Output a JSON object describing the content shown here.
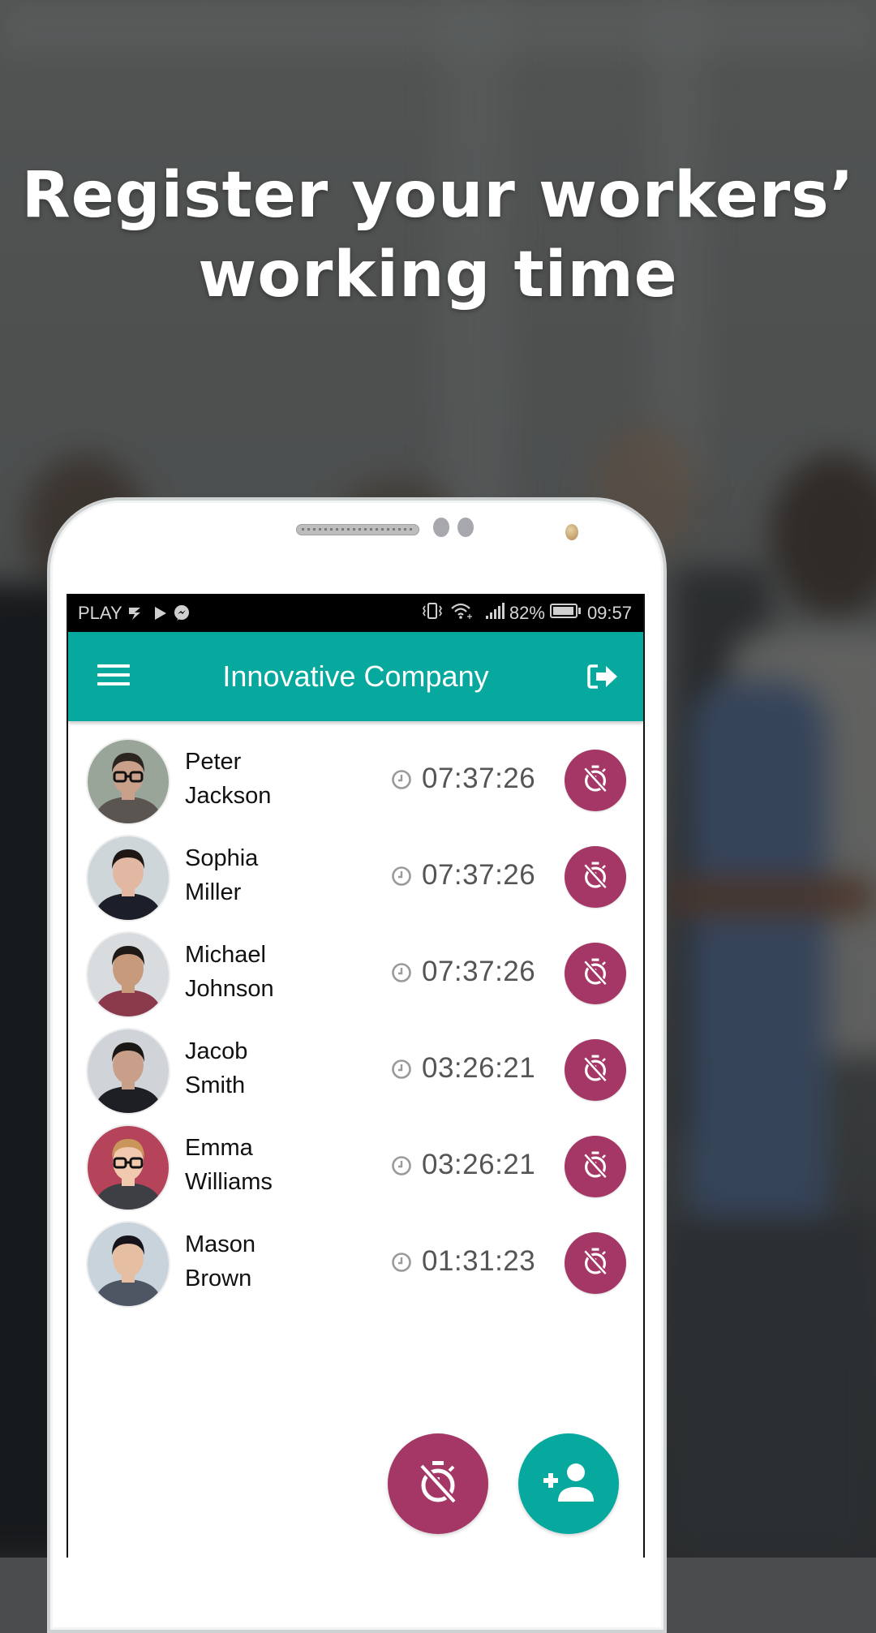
{
  "headline": {
    "line1": "Register your workers’",
    "line2": "working time"
  },
  "status_bar": {
    "carrier": "PLAY",
    "left_icons": [
      "notification-check-icon",
      "play-store-icon",
      "messenger-icon"
    ],
    "right_icons": [
      "vibrate-icon",
      "wifi-icon",
      "signal-icon",
      "battery-icon"
    ],
    "battery": "82%",
    "time": "09:57"
  },
  "app_bar": {
    "title": "Innovative Company",
    "menu_icon": "hamburger-menu-icon",
    "exit_icon": "logout-icon"
  },
  "workers": [
    {
      "first_name": "Peter",
      "last_name": "Jackson",
      "time": "07:37:26",
      "avatar": {
        "skin": "#c9a08a",
        "hair": "#2b241f",
        "shirt": "#5b5552",
        "bg": "#9aa59a",
        "glasses": true
      }
    },
    {
      "first_name": "Sophia",
      "last_name": "Miller",
      "time": "07:37:26",
      "avatar": {
        "skin": "#e2b8a2",
        "hair": "#1e1714",
        "shirt": "#1c1f2a",
        "bg": "#cfd6da",
        "glasses": false
      }
    },
    {
      "first_name": "Michael",
      "last_name": "Johnson",
      "time": "07:37:26",
      "avatar": {
        "skin": "#c79a7c",
        "hair": "#1f1915",
        "shirt": "#8a3a4a",
        "bg": "#d8dcdf",
        "glasses": false
      }
    },
    {
      "first_name": "Jacob",
      "last_name": "Smith",
      "time": "03:26:21",
      "avatar": {
        "skin": "#c8a08a",
        "hair": "#1b1715",
        "shirt": "#1e1f24",
        "bg": "#d0d4d8",
        "glasses": false
      }
    },
    {
      "first_name": "Emma",
      "last_name": "Williams",
      "time": "03:26:21",
      "avatar": {
        "skin": "#f0c9ae",
        "hair": "#c9955a",
        "shirt": "#3d3f45",
        "bg": "#b5435a",
        "glasses": true
      }
    },
    {
      "first_name": "Mason",
      "last_name": "Brown",
      "time": "01:31:23",
      "avatar": {
        "skin": "#e6bea2",
        "hair": "#16141a",
        "shirt": "#4e5563",
        "bg": "#c9d3dc",
        "glasses": false
      }
    }
  ],
  "row_action_icon": "timer-off-icon",
  "fabs": {
    "stop_all_icon": "timer-off-icon",
    "add_worker_icon": "person-add-icon"
  },
  "colors": {
    "primary_teal": "#07a99e",
    "accent_magenta": "#a43766",
    "status_bar": "#000000",
    "time_text": "#555555"
  }
}
